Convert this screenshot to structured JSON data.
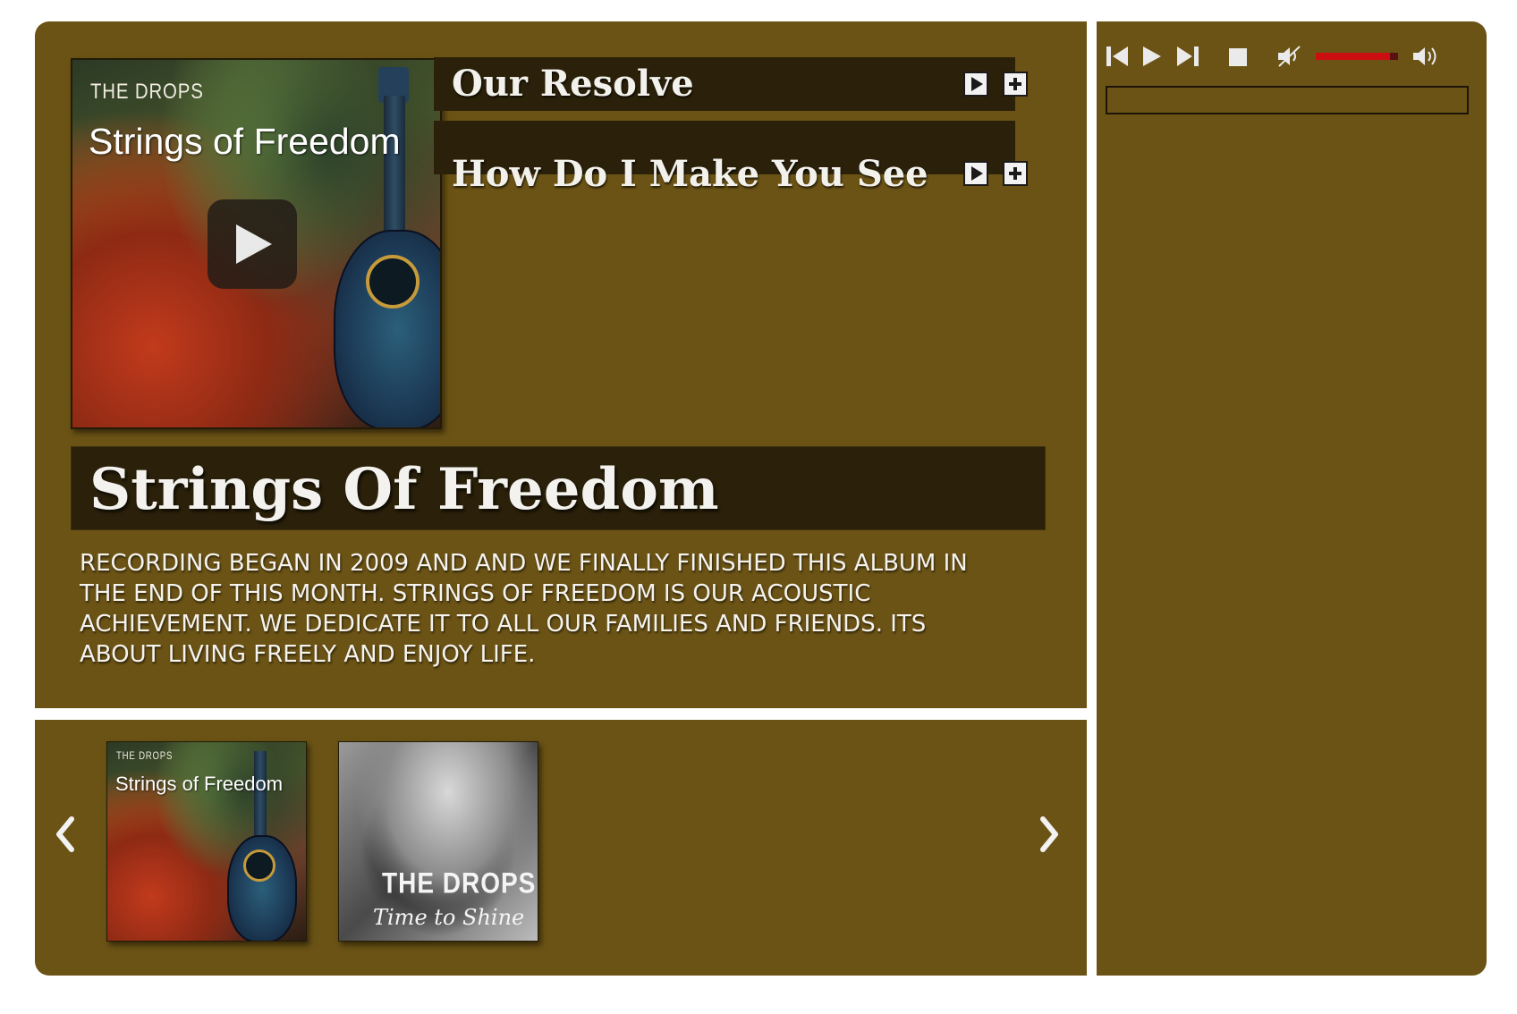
{
  "featured": {
    "cover_band": "THE DROPS",
    "cover_title": "Strings of Freedom",
    "play_icon": "play-icon"
  },
  "tracks": [
    {
      "title": "Our Resolve"
    },
    {
      "title": "How Do I Make You See"
    }
  ],
  "album": {
    "title": "Strings Of Freedom",
    "description": "RECORDING BEGAN IN 2009 AND AND WE FINALLY FINISHED THIS ALBUM IN THE END OF THIS MONTH. STRINGS OF FREEDOM IS OUR ACOUSTIC ACHIEVEMENT. WE DEDICATE IT TO ALL OUR FAMILIES AND FRIENDS. ITS ABOUT LIVING FREELY AND ENJOY LIFE."
  },
  "carousel": {
    "prev_icon": "chevron-left-icon",
    "next_icon": "chevron-right-icon",
    "items": [
      {
        "band": "THE DROPS",
        "title": "Strings of Freedom"
      },
      {
        "band": "THE DROPS",
        "title": "Time to Shine"
      }
    ]
  },
  "player": {
    "controls": [
      "previous-icon",
      "play-icon",
      "next-icon",
      "stop-icon",
      "mute-icon",
      "volume-max-icon"
    ],
    "volume": 0.9,
    "colors": {
      "panel": "#6b5315",
      "dark_bar": "#2b210a",
      "volume": "#cc0e10"
    }
  }
}
